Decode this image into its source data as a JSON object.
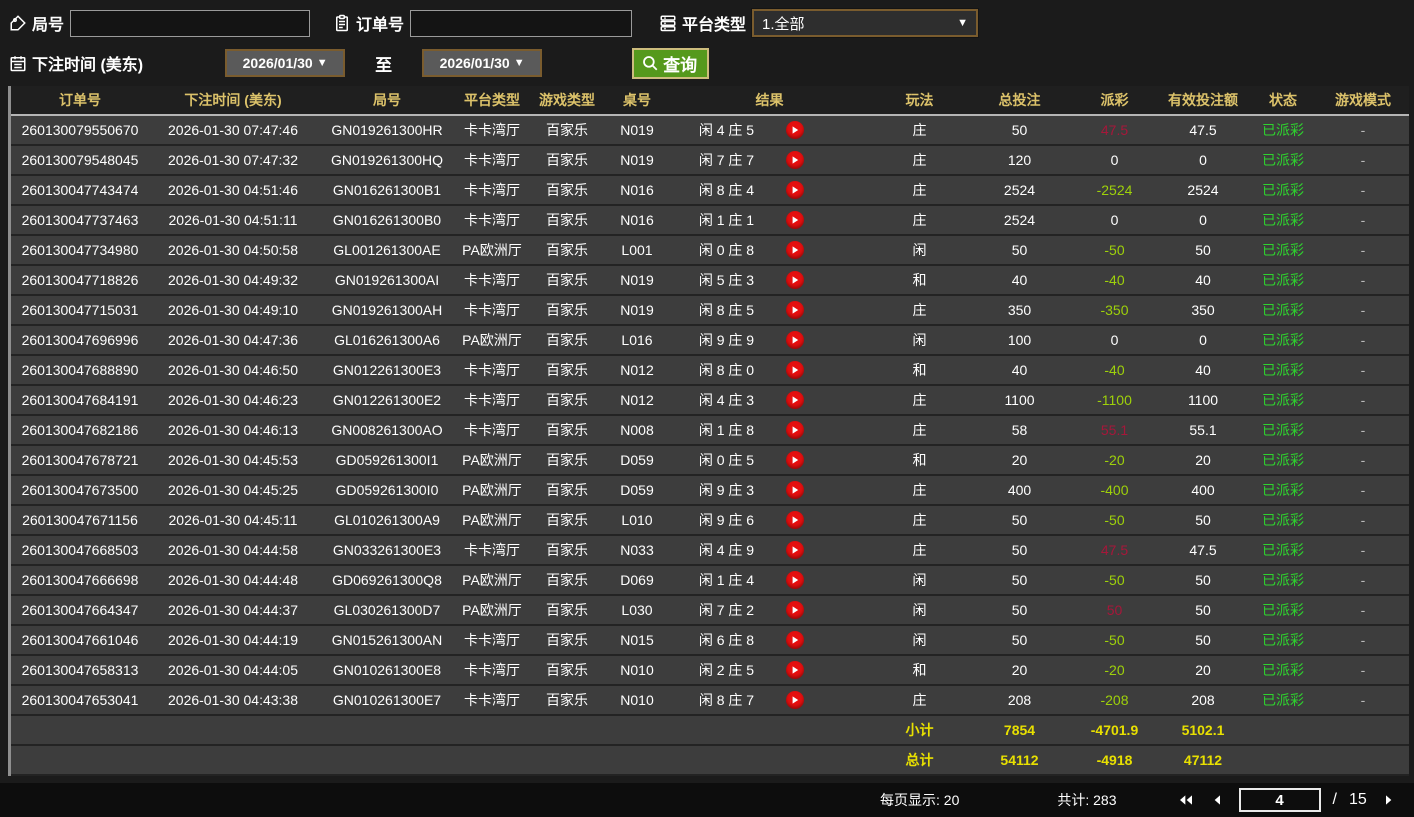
{
  "colors": {
    "header_text": "#dcc26a",
    "payout_positive": "#a6173a",
    "payout_negative": "#9ed10a",
    "status_green": "#2ed32e",
    "totals_yellow": "#e8e000",
    "query_button_green": "#55991c",
    "play_button_red": "#e50f0f"
  },
  "filters": {
    "round_label": "局号",
    "round_value": "",
    "order_label": "订单号",
    "order_value": "",
    "platform_label": "平台类型",
    "platform_value": "1.全部",
    "bet_time_label": "下注时间 (美东)",
    "date_from": "2026/01/30",
    "to_label": "至",
    "date_to": "2026/01/30",
    "query_label": "查询"
  },
  "table": {
    "columns": [
      "订单号",
      "下注时间 (美东)",
      "局号",
      "平台类型",
      "游戏类型",
      "桌号",
      "结果",
      "玩法",
      "总投注",
      "派彩",
      "有效投注额",
      "状态",
      "游戏模式"
    ],
    "rows": [
      {
        "order": "260130079550670",
        "time": "2026-01-30 07:47:46",
        "round": "GN019261300HR",
        "platform": "卡卡湾厅",
        "game": "百家乐",
        "table_no": "N019",
        "result": "闲 4 庄 5",
        "bet_type": "庄",
        "total_bet": "50",
        "payout": "47.5",
        "valid_bet": "47.5",
        "status": "已派彩",
        "mode": "-"
      },
      {
        "order": "260130079548045",
        "time": "2026-01-30 07:47:32",
        "round": "GN019261300HQ",
        "platform": "卡卡湾厅",
        "game": "百家乐",
        "table_no": "N019",
        "result": "闲 7 庄 7",
        "bet_type": "庄",
        "total_bet": "120",
        "payout": "0",
        "valid_bet": "0",
        "status": "已派彩",
        "mode": "-"
      },
      {
        "order": "260130047743474",
        "time": "2026-01-30 04:51:46",
        "round": "GN016261300B1",
        "platform": "卡卡湾厅",
        "game": "百家乐",
        "table_no": "N016",
        "result": "闲 8 庄 4",
        "bet_type": "庄",
        "total_bet": "2524",
        "payout": "-2524",
        "valid_bet": "2524",
        "status": "已派彩",
        "mode": "-"
      },
      {
        "order": "260130047737463",
        "time": "2026-01-30 04:51:11",
        "round": "GN016261300B0",
        "platform": "卡卡湾厅",
        "game": "百家乐",
        "table_no": "N016",
        "result": "闲 1 庄 1",
        "bet_type": "庄",
        "total_bet": "2524",
        "payout": "0",
        "valid_bet": "0",
        "status": "已派彩",
        "mode": "-"
      },
      {
        "order": "260130047734980",
        "time": "2026-01-30 04:50:58",
        "round": "GL001261300AE",
        "platform": "PA欧洲厅",
        "game": "百家乐",
        "table_no": "L001",
        "result": "闲 0 庄 8",
        "bet_type": "闲",
        "total_bet": "50",
        "payout": "-50",
        "valid_bet": "50",
        "status": "已派彩",
        "mode": "-"
      },
      {
        "order": "260130047718826",
        "time": "2026-01-30 04:49:32",
        "round": "GN019261300AI",
        "platform": "卡卡湾厅",
        "game": "百家乐",
        "table_no": "N019",
        "result": "闲 5 庄 3",
        "bet_type": "和",
        "total_bet": "40",
        "payout": "-40",
        "valid_bet": "40",
        "status": "已派彩",
        "mode": "-"
      },
      {
        "order": "260130047715031",
        "time": "2026-01-30 04:49:10",
        "round": "GN019261300AH",
        "platform": "卡卡湾厅",
        "game": "百家乐",
        "table_no": "N019",
        "result": "闲 8 庄 5",
        "bet_type": "庄",
        "total_bet": "350",
        "payout": "-350",
        "valid_bet": "350",
        "status": "已派彩",
        "mode": "-"
      },
      {
        "order": "260130047696996",
        "time": "2026-01-30 04:47:36",
        "round": "GL016261300A6",
        "platform": "PA欧洲厅",
        "game": "百家乐",
        "table_no": "L016",
        "result": "闲 9 庄 9",
        "bet_type": "闲",
        "total_bet": "100",
        "payout": "0",
        "valid_bet": "0",
        "status": "已派彩",
        "mode": "-"
      },
      {
        "order": "260130047688890",
        "time": "2026-01-30 04:46:50",
        "round": "GN012261300E3",
        "platform": "卡卡湾厅",
        "game": "百家乐",
        "table_no": "N012",
        "result": "闲 8 庄 0",
        "bet_type": "和",
        "total_bet": "40",
        "payout": "-40",
        "valid_bet": "40",
        "status": "已派彩",
        "mode": "-"
      },
      {
        "order": "260130047684191",
        "time": "2026-01-30 04:46:23",
        "round": "GN012261300E2",
        "platform": "卡卡湾厅",
        "game": "百家乐",
        "table_no": "N012",
        "result": "闲 4 庄 3",
        "bet_type": "庄",
        "total_bet": "1100",
        "payout": "-1100",
        "valid_bet": "1100",
        "status": "已派彩",
        "mode": "-"
      },
      {
        "order": "260130047682186",
        "time": "2026-01-30 04:46:13",
        "round": "GN008261300AO",
        "platform": "卡卡湾厅",
        "game": "百家乐",
        "table_no": "N008",
        "result": "闲 1 庄 8",
        "bet_type": "庄",
        "total_bet": "58",
        "payout": "55.1",
        "valid_bet": "55.1",
        "status": "已派彩",
        "mode": "-"
      },
      {
        "order": "260130047678721",
        "time": "2026-01-30 04:45:53",
        "round": "GD059261300I1",
        "platform": "PA欧洲厅",
        "game": "百家乐",
        "table_no": "D059",
        "result": "闲 0 庄 5",
        "bet_type": "和",
        "total_bet": "20",
        "payout": "-20",
        "valid_bet": "20",
        "status": "已派彩",
        "mode": "-"
      },
      {
        "order": "260130047673500",
        "time": "2026-01-30 04:45:25",
        "round": "GD059261300I0",
        "platform": "PA欧洲厅",
        "game": "百家乐",
        "table_no": "D059",
        "result": "闲 9 庄 3",
        "bet_type": "庄",
        "total_bet": "400",
        "payout": "-400",
        "valid_bet": "400",
        "status": "已派彩",
        "mode": "-"
      },
      {
        "order": "260130047671156",
        "time": "2026-01-30 04:45:11",
        "round": "GL010261300A9",
        "platform": "PA欧洲厅",
        "game": "百家乐",
        "table_no": "L010",
        "result": "闲 9 庄 6",
        "bet_type": "庄",
        "total_bet": "50",
        "payout": "-50",
        "valid_bet": "50",
        "status": "已派彩",
        "mode": "-"
      },
      {
        "order": "260130047668503",
        "time": "2026-01-30 04:44:58",
        "round": "GN033261300E3",
        "platform": "卡卡湾厅",
        "game": "百家乐",
        "table_no": "N033",
        "result": "闲 4 庄 9",
        "bet_type": "庄",
        "total_bet": "50",
        "payout": "47.5",
        "valid_bet": "47.5",
        "status": "已派彩",
        "mode": "-"
      },
      {
        "order": "260130047666698",
        "time": "2026-01-30 04:44:48",
        "round": "GD069261300Q8",
        "platform": "PA欧洲厅",
        "game": "百家乐",
        "table_no": "D069",
        "result": "闲 1 庄 4",
        "bet_type": "闲",
        "total_bet": "50",
        "payout": "-50",
        "valid_bet": "50",
        "status": "已派彩",
        "mode": "-"
      },
      {
        "order": "260130047664347",
        "time": "2026-01-30 04:44:37",
        "round": "GL030261300D7",
        "platform": "PA欧洲厅",
        "game": "百家乐",
        "table_no": "L030",
        "result": "闲 7 庄 2",
        "bet_type": "闲",
        "total_bet": "50",
        "payout": "50",
        "valid_bet": "50",
        "status": "已派彩",
        "mode": "-"
      },
      {
        "order": "260130047661046",
        "time": "2026-01-30 04:44:19",
        "round": "GN015261300AN",
        "platform": "卡卡湾厅",
        "game": "百家乐",
        "table_no": "N015",
        "result": "闲 6 庄 8",
        "bet_type": "闲",
        "total_bet": "50",
        "payout": "-50",
        "valid_bet": "50",
        "status": "已派彩",
        "mode": "-"
      },
      {
        "order": "260130047658313",
        "time": "2026-01-30 04:44:05",
        "round": "GN010261300E8",
        "platform": "卡卡湾厅",
        "game": "百家乐",
        "table_no": "N010",
        "result": "闲 2 庄 5",
        "bet_type": "和",
        "total_bet": "20",
        "payout": "-20",
        "valid_bet": "20",
        "status": "已派彩",
        "mode": "-"
      },
      {
        "order": "260130047653041",
        "time": "2026-01-30 04:43:38",
        "round": "GN010261300E7",
        "platform": "卡卡湾厅",
        "game": "百家乐",
        "table_no": "N010",
        "result": "闲 8 庄 7",
        "bet_type": "庄",
        "total_bet": "208",
        "payout": "-208",
        "valid_bet": "208",
        "status": "已派彩",
        "mode": "-"
      }
    ],
    "subtotal": {
      "label": "小计",
      "total_bet": "7854",
      "payout": "-4701.9",
      "valid_bet": "5102.1"
    },
    "total": {
      "label": "总计",
      "total_bet": "54112",
      "payout": "-4918",
      "valid_bet": "47112"
    }
  },
  "footer": {
    "page_size_label": "每页显示:",
    "page_size": "20",
    "total_count_label": "共计:",
    "total_count": "283",
    "current_page": "4",
    "page_slash": "/",
    "total_pages": "15"
  }
}
